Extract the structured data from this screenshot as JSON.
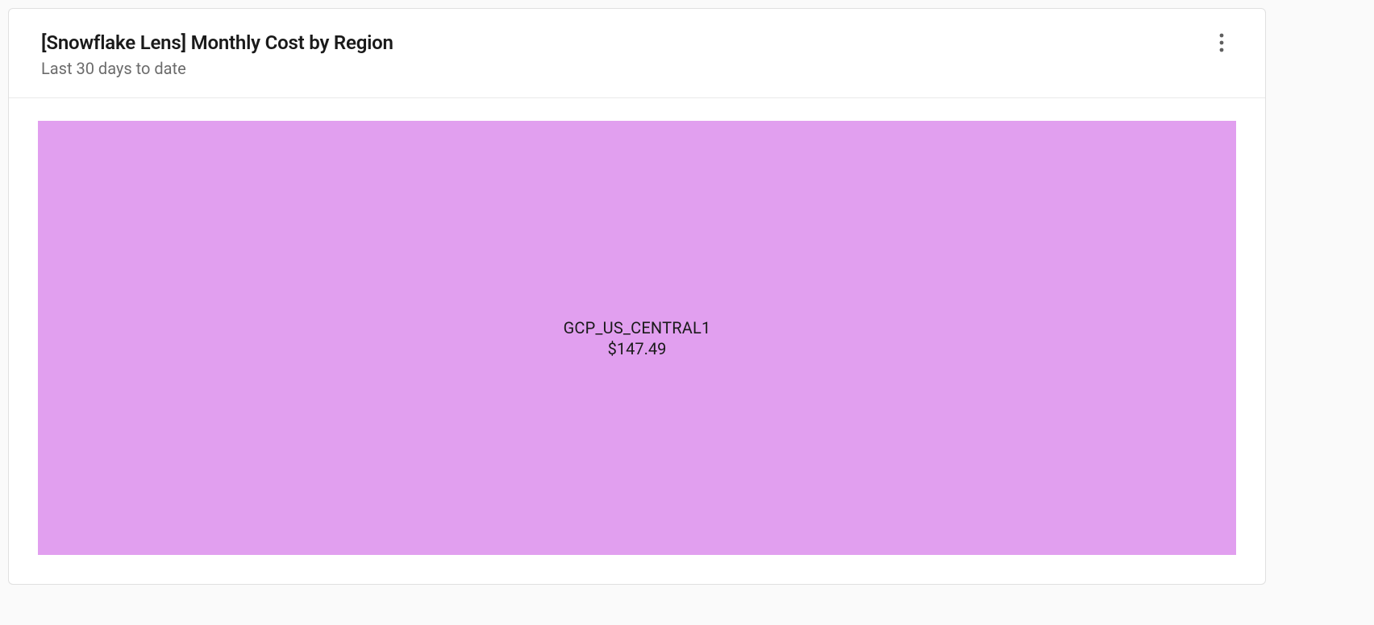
{
  "header": {
    "title": "[Snowflake Lens] Monthly Cost by Region",
    "subtitle": "Last 30 days to date"
  },
  "chart_data": {
    "type": "treemap",
    "title": "[Snowflake Lens] Monthly Cost by Region",
    "categories": [
      "GCP_US_CENTRAL1"
    ],
    "values": [
      147.49
    ],
    "series": [
      {
        "name": "GCP_US_CENTRAL1",
        "value": 147.49,
        "value_label": "$147.49",
        "color": "#e19fef"
      }
    ]
  }
}
